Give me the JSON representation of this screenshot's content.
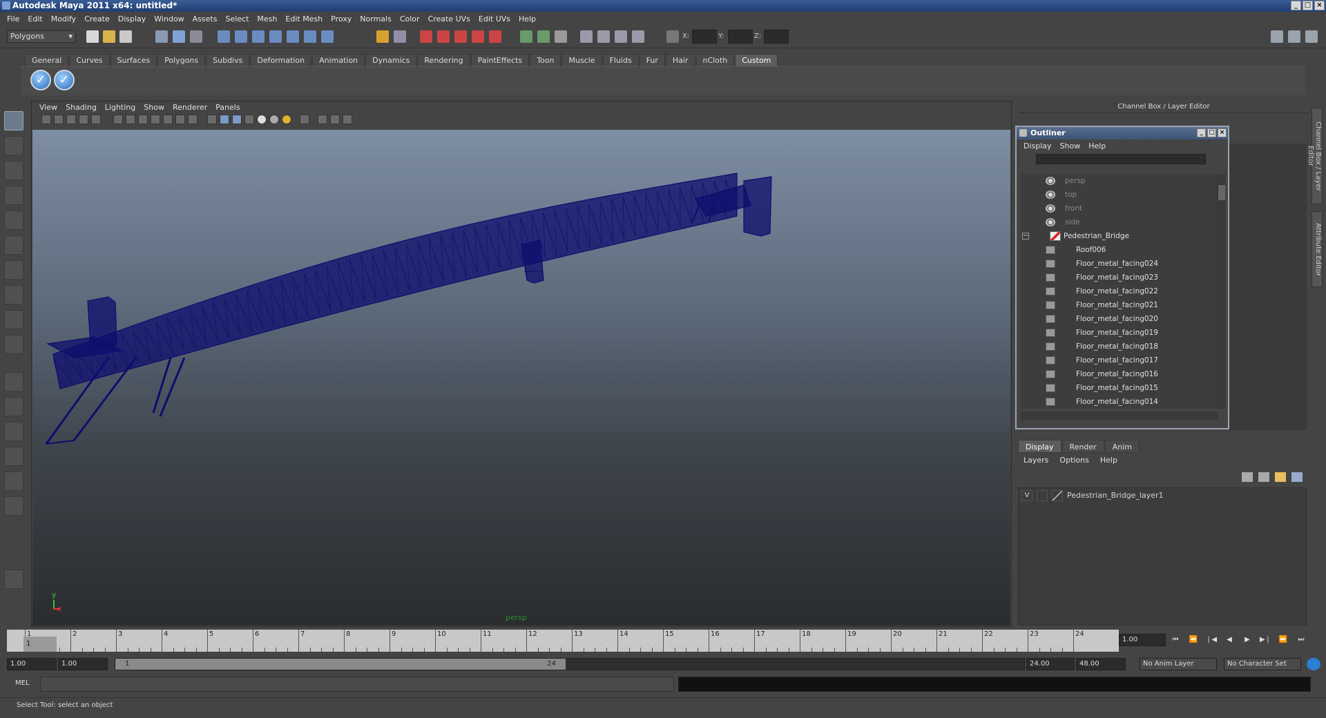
{
  "window": {
    "title": "Autodesk Maya 2011 x64: untitled*"
  },
  "menubar": [
    "File",
    "Edit",
    "Modify",
    "Create",
    "Display",
    "Window",
    "Assets",
    "Select",
    "Mesh",
    "Edit Mesh",
    "Proxy",
    "Normals",
    "Color",
    "Create UVs",
    "Edit UVs",
    "Help"
  ],
  "statusline": {
    "mode": "Polygons",
    "x_label": "X:",
    "y_label": "Y:",
    "z_label": "Z:"
  },
  "shelf": {
    "tabs": [
      "General",
      "Curves",
      "Surfaces",
      "Polygons",
      "Subdivs",
      "Deformation",
      "Animation",
      "Dynamics",
      "Rendering",
      "PaintEffects",
      "Toon",
      "Muscle",
      "Fluids",
      "Fur",
      "Hair",
      "nCloth",
      "Custom"
    ],
    "active_tab": "Custom",
    "buttons": [
      "✓",
      "✓"
    ]
  },
  "viewport": {
    "menu": [
      "View",
      "Shading",
      "Lighting",
      "Show",
      "Renderer",
      "Panels"
    ],
    "camera": "persp",
    "axis_y": "y",
    "axis_x": "x",
    "wire_color": "#0d0d6e"
  },
  "channel_box": {
    "header": "Channel Box / Layer Editor",
    "side_tabs": [
      "Channel Box / Layer Editor",
      "Attribute Editor"
    ]
  },
  "outliner": {
    "title": "Outliner",
    "menu": [
      "Display",
      "Show",
      "Help"
    ],
    "items": [
      {
        "label": "persp",
        "type": "camera"
      },
      {
        "label": "top",
        "type": "camera"
      },
      {
        "label": "front",
        "type": "camera"
      },
      {
        "label": "side",
        "type": "camera"
      },
      {
        "label": "Pedestrian_Bridge",
        "type": "group"
      },
      {
        "label": "Roof006",
        "type": "mesh"
      },
      {
        "label": "Floor_metal_facing024",
        "type": "mesh"
      },
      {
        "label": "Floor_metal_facing023",
        "type": "mesh"
      },
      {
        "label": "Floor_metal_facing022",
        "type": "mesh"
      },
      {
        "label": "Floor_metal_facing021",
        "type": "mesh"
      },
      {
        "label": "Floor_metal_facing020",
        "type": "mesh"
      },
      {
        "label": "Floor_metal_facing019",
        "type": "mesh"
      },
      {
        "label": "Floor_metal_facing018",
        "type": "mesh"
      },
      {
        "label": "Floor_metal_facing017",
        "type": "mesh"
      },
      {
        "label": "Floor_metal_facing016",
        "type": "mesh"
      },
      {
        "label": "Floor_metal_facing015",
        "type": "mesh"
      },
      {
        "label": "Floor_metal_facing014",
        "type": "mesh"
      }
    ],
    "collapse_glyph": "−"
  },
  "layer_editor": {
    "tabs": [
      "Display",
      "Render",
      "Anim"
    ],
    "active_tab": "Display",
    "menu": [
      "Layers",
      "Options",
      "Help"
    ],
    "layers": [
      {
        "visible": "V",
        "name": "Pedestrian_Bridge_layer1"
      }
    ]
  },
  "timeline": {
    "frames": [
      "1",
      "2",
      "3",
      "4",
      "5",
      "6",
      "7",
      "8",
      "9",
      "10",
      "11",
      "12",
      "13",
      "14",
      "15",
      "16",
      "17",
      "18",
      "19",
      "20",
      "21",
      "22",
      "23",
      "24"
    ],
    "current_frame_marker": "1",
    "current_time": "1.00"
  },
  "range": {
    "start": "1.00",
    "playback_start": "1.00",
    "slider_start": "1",
    "slider_end": "24",
    "playback_end": "24.00",
    "end": "48.00",
    "anim_layer": "No Anim Layer",
    "character_set": "No Character Set"
  },
  "command_line": {
    "label": "MEL"
  },
  "help_line": {
    "text": "Select Tool: select an object"
  }
}
